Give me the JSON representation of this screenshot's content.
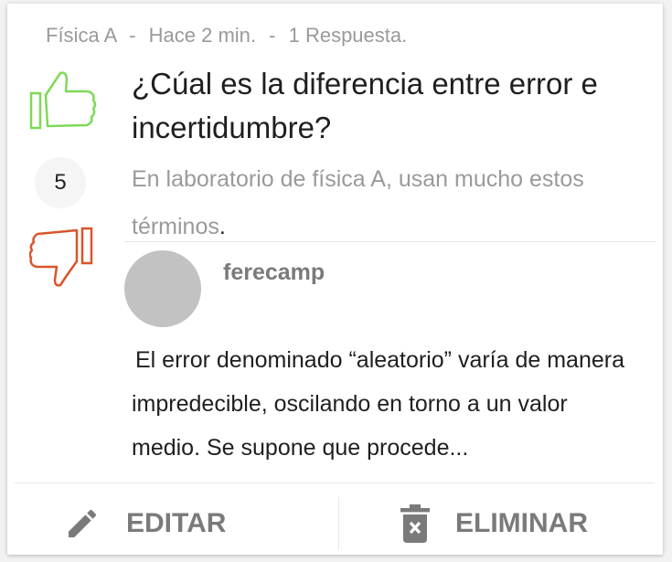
{
  "post": {
    "course": "Física A",
    "time": "Hace 2 min.",
    "answers": "1 Respuesta.",
    "meta_separator": "-",
    "score": "5",
    "title": "¿Cúal es la diferencia entre error e incertidumbre?",
    "description": "En laboratorio de física A, usan mucho estos términos",
    "description_end": "."
  },
  "answer": {
    "author": "ferecamp",
    "text": "El error denominado “aleatorio” varía de manera impredecible, oscilando en torno a un valor medio. Se supone que procede..."
  },
  "actions": {
    "edit_label": "EDITAR",
    "delete_label": "ELIMINAR"
  },
  "colors": {
    "upvote": "#7ed957",
    "downvote": "#d9552a",
    "avatar": "#c2c2c2",
    "muted_text": "#9a9a9a",
    "action_text": "#7a7a7a"
  },
  "icons": {
    "upvote": "thumb-up-icon",
    "downvote": "thumb-down-icon",
    "edit": "pencil-icon",
    "delete": "trash-icon"
  }
}
